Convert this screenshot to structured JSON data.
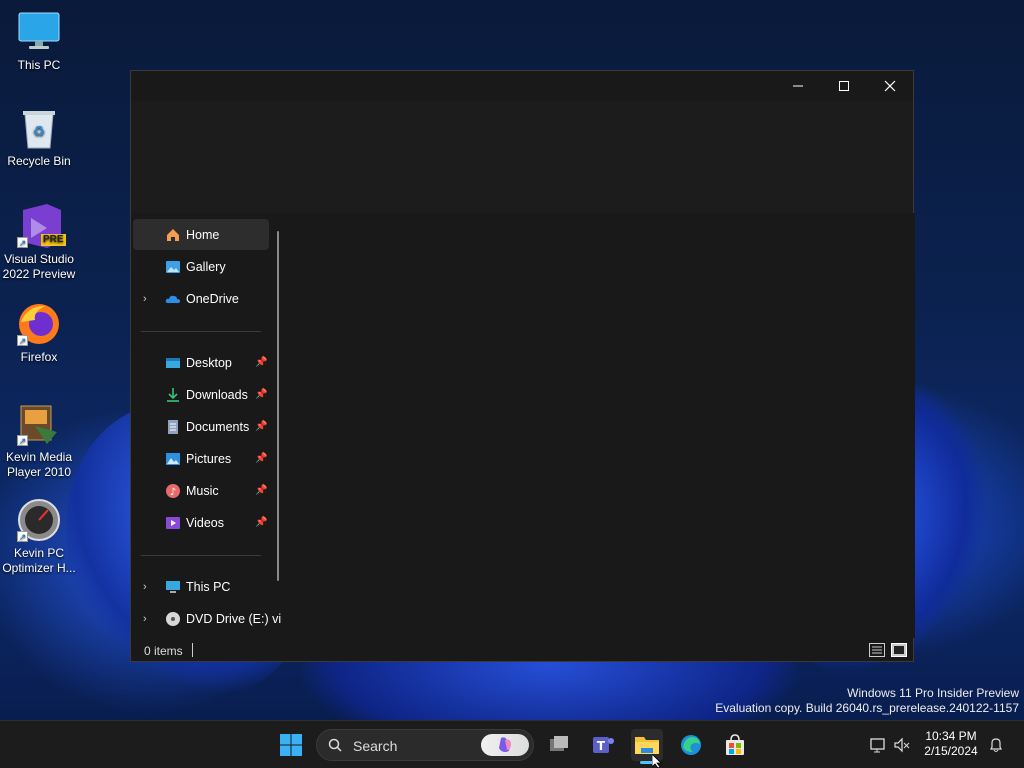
{
  "desktop": {
    "icons": [
      {
        "label": "This PC"
      },
      {
        "label": "Recycle Bin"
      },
      {
        "label": "Visual Studio 2022 Preview",
        "badge": "PRE"
      },
      {
        "label": "Firefox"
      },
      {
        "label": "Kevin Media Player 2010"
      },
      {
        "label": "Kevin PC Optimizer H..."
      }
    ]
  },
  "explorer": {
    "controls": {
      "minimize": "—",
      "maximize": "☐",
      "close": "✕"
    },
    "nav": [
      {
        "label": "Home",
        "icon": "home-icon"
      },
      {
        "label": "Gallery",
        "icon": "gallery-icon"
      },
      {
        "label": "OneDrive",
        "icon": "cloud-icon",
        "chevron": "›"
      },
      {
        "label": "Desktop",
        "icon": "desktop-icon"
      },
      {
        "label": "Downloads",
        "icon": "download-icon"
      },
      {
        "label": "Documents",
        "icon": "document-icon"
      },
      {
        "label": "Pictures",
        "icon": "picture-icon"
      },
      {
        "label": "Music",
        "icon": "music-icon"
      },
      {
        "label": "Videos",
        "icon": "video-icon"
      },
      {
        "label": "This PC",
        "icon": "computer-icon",
        "chevron": "›"
      },
      {
        "label": "DVD Drive (E:) vi",
        "icon": "disc-icon",
        "chevron": "›"
      }
    ],
    "status": {
      "item_count": "0 items"
    }
  },
  "watermark": {
    "line1": "Windows 11 Pro Insider Preview",
    "line2": "Evaluation copy. Build 26040.rs_prerelease.240122-1157"
  },
  "taskbar": {
    "search_label": "Search",
    "clock_time": "10:34 PM",
    "clock_date": "2/15/2024"
  },
  "colors": {
    "accent": "#4cc2ff",
    "window_bg": "#191919",
    "taskbar_bg": "#1c1c1c"
  }
}
